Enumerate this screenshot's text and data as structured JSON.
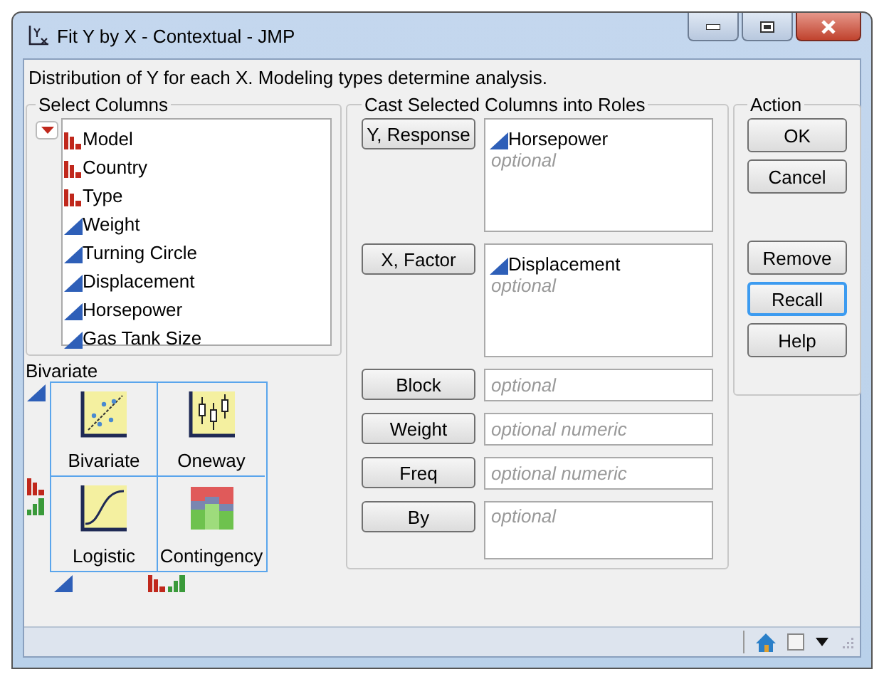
{
  "window": {
    "title": "Fit Y by X - Contextual - JMP"
  },
  "status_bar": {
    "checked": false
  },
  "description": "Distribution of Y for each X. Modeling types determine analysis.",
  "select_columns": {
    "title": "Select Columns",
    "columns": [
      {
        "name": "Model",
        "kind": "nominal"
      },
      {
        "name": "Country",
        "kind": "nominal"
      },
      {
        "name": "Type",
        "kind": "nominal"
      },
      {
        "name": "Weight",
        "kind": "continuous"
      },
      {
        "name": "Turning Circle",
        "kind": "continuous"
      },
      {
        "name": "Displacement",
        "kind": "continuous"
      },
      {
        "name": "Horsepower",
        "kind": "continuous"
      },
      {
        "name": "Gas Tank Size",
        "kind": "continuous"
      }
    ]
  },
  "analysis": {
    "title": "Bivariate",
    "cells": [
      {
        "label": "Bivariate",
        "kind": "bivariate"
      },
      {
        "label": "Oneway",
        "kind": "oneway"
      },
      {
        "label": "Logistic",
        "kind": "logistic"
      },
      {
        "label": "Contingency",
        "kind": "contingency"
      }
    ]
  },
  "roles": {
    "title": "Cast Selected Columns into Roles",
    "rows": [
      {
        "button": "Y, Response",
        "kind": "list",
        "items": [
          {
            "name": "Horsepower",
            "kind": "continuous"
          }
        ],
        "placeholder": "optional"
      },
      {
        "button": "X, Factor",
        "kind": "list",
        "items": [
          {
            "name": "Displacement",
            "kind": "continuous"
          }
        ],
        "placeholder": "optional"
      },
      {
        "button": "Block",
        "kind": "field",
        "placeholder": "optional"
      },
      {
        "button": "Weight",
        "kind": "field",
        "placeholder": "optional numeric"
      },
      {
        "button": "Freq",
        "kind": "field",
        "placeholder": "optional numeric"
      },
      {
        "button": "By",
        "kind": "box",
        "placeholder": "optional"
      }
    ]
  },
  "action": {
    "title": "Action",
    "groups": [
      [
        {
          "label": "OK",
          "focused": false
        },
        {
          "label": "Cancel",
          "focused": false
        }
      ],
      [
        {
          "label": "Remove",
          "focused": false
        },
        {
          "label": "Recall",
          "focused": true
        },
        {
          "label": "Help",
          "focused": false
        }
      ]
    ]
  }
}
